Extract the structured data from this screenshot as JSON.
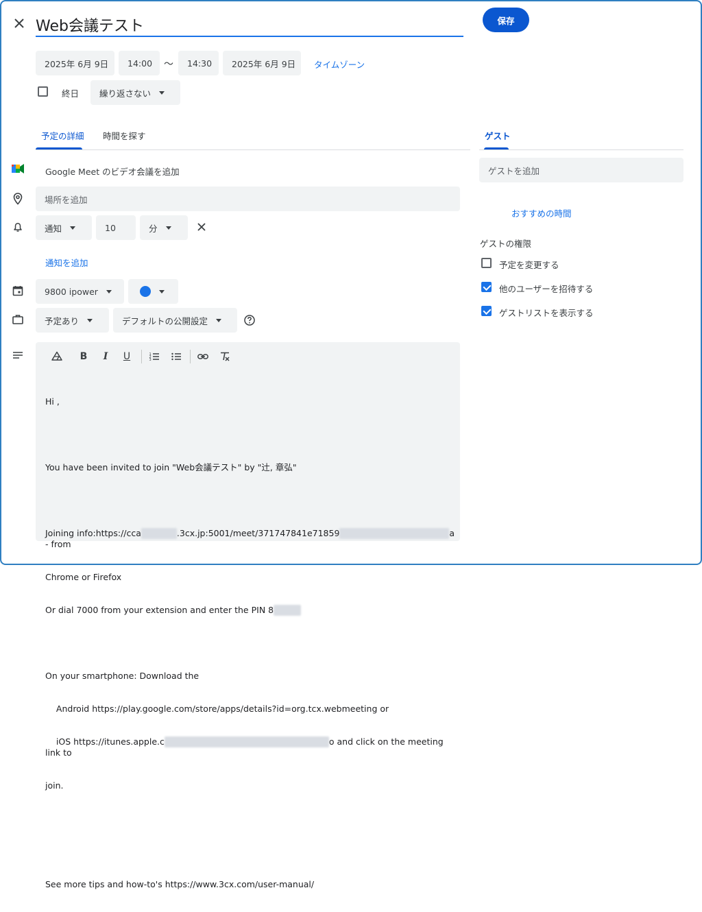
{
  "header": {
    "title": "Web会議テスト",
    "save_label": "保存"
  },
  "datetime": {
    "start_date": "2025年 6月 9日",
    "start_time": "14:00",
    "separator": "〜",
    "end_time": "14:30",
    "end_date": "2025年 6月 9日",
    "timezone_label": "タイムゾーン",
    "all_day_label": "終日",
    "repeat_value": "繰り返さない"
  },
  "tabs": {
    "details": "予定の詳細",
    "find_time": "時間を探す",
    "guests": "ゲスト"
  },
  "details": {
    "meet_label": "Google Meet のビデオ会議を追加",
    "location_placeholder": "場所を追加",
    "notification_type": "通知",
    "notification_value": "10",
    "notification_unit": "分",
    "add_notification": "通知を追加",
    "calendar_name": "9800 ipower",
    "event_color": "#1a73e8",
    "availability": "予定あり",
    "visibility": "デフォルトの公開設定"
  },
  "description": {
    "line1": "Hi ,",
    "line2": "You have been invited to join \"Web会議テスト\" by \"辻, 章弘\"",
    "line3a": "Joining info:https://cca",
    "line3b": ".3cx.jp:5001/meet/371747841e71859",
    "line3c": "a - from",
    "line4": "Chrome or Firefox",
    "line5": "Or dial 7000 from your extension and enter the PIN 8",
    "line6": "On your smartphone: Download the",
    "line7": "    Android https://play.google.com/store/apps/details?id=org.tcx.webmeeting or",
    "line8a": "    iOS https://itunes.apple.c",
    "line8b": "o and click on the meeting link to",
    "line9": "join.",
    "line10": "See more tips and how-to's https://www.3cx.com/user-manual/"
  },
  "guests": {
    "add_placeholder": "ゲストを追加",
    "suggested_times": "おすすめの時間",
    "permissions_title": "ゲストの権限",
    "permissions": [
      {
        "label": "予定を変更する",
        "checked": false
      },
      {
        "label": "他のユーザーを招待する",
        "checked": true
      },
      {
        "label": "ゲストリストを表示する",
        "checked": true
      }
    ]
  },
  "icons": [
    "close-icon",
    "google-meet-icon",
    "location-pin-icon",
    "bell-icon",
    "calendar-icon",
    "briefcase-icon",
    "description-icon",
    "help-icon",
    "drive-icon",
    "bold-icon",
    "italic-icon",
    "underline-icon",
    "numbered-list-icon",
    "bulleted-list-icon",
    "link-icon",
    "clear-format-icon"
  ]
}
